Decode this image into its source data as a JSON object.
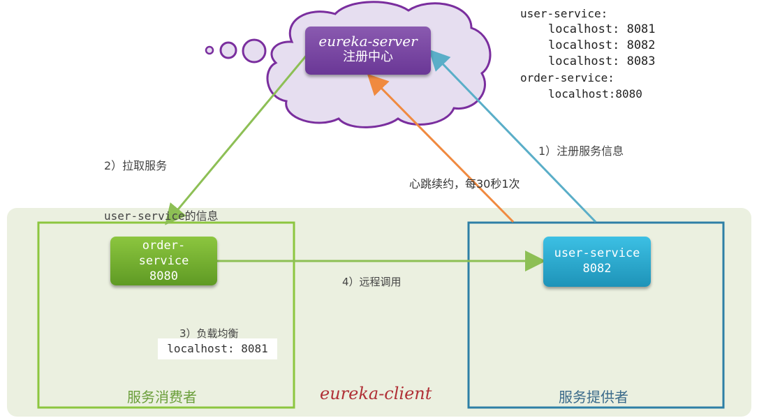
{
  "server": {
    "name": "eureka-server",
    "subtitle": "注册中心"
  },
  "registry": {
    "lines": [
      {
        "text": "user-service:",
        "indent": false,
        "big": false
      },
      {
        "text": "localhost: 8081",
        "indent": true,
        "big": true
      },
      {
        "text": "localhost: 8082",
        "indent": true,
        "big": true
      },
      {
        "text": "localhost: 8083",
        "indent": true,
        "big": true
      },
      {
        "text": "order-service:",
        "indent": false,
        "big": false
      },
      {
        "text": "localhost:8080",
        "indent": true,
        "big": false
      }
    ]
  },
  "labels": {
    "pull_line1": "2）拉取服务",
    "pull_line2": "user-service的信息",
    "register": "1）注册服务信息",
    "heartbeat": "心跳续约，每30秒1次",
    "remote_call": "4）远程调用",
    "load_balance": "3）负载均衡",
    "load_balance_result": "localhost: 8081",
    "consumer": "服务消费者",
    "provider": "服务提供者",
    "client": "eureka-client"
  },
  "order_service": {
    "name": "order-service",
    "port": "8080"
  },
  "user_service": {
    "name": "user-service",
    "port": "8082"
  },
  "colors": {
    "client_area": "#ebf0e0",
    "consumer_border": "#8cc63f",
    "provider_border": "#2e7fa6",
    "cloud_fill": "#e6def0",
    "cloud_stroke": "#7a2e9e",
    "pull_arrow": "#8dbf55",
    "heartbeat_arrow": "#f08a40",
    "register_arrow": "#5aaec8",
    "call_arrow": "#8dbf55"
  }
}
